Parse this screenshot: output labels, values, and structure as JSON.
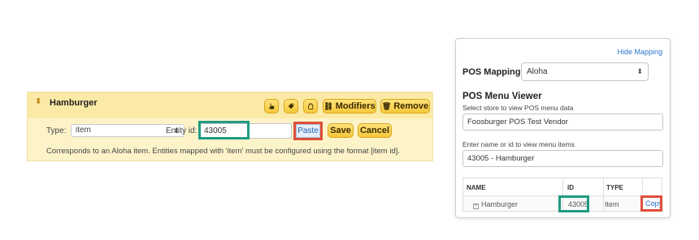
{
  "entity": {
    "name": "Hamburger",
    "sort_icon": "sort-arrows-icon",
    "toolbar": {
      "icon1": "hand-pointer-icon",
      "icon2": "tag-icon",
      "icon3": "hand-icon",
      "modifiers_label": "Modifiers",
      "remove_label": "Remove"
    },
    "type_label": "Type:",
    "type_value": "item",
    "entity_label": "Entity id:",
    "entity_value": "43005",
    "paste_label": "Paste",
    "save_label": "Save",
    "cancel_label": "Cancel",
    "help_text": "Corresponds to an Aloha item. Entities mapped with 'item' must be configured using the format [item id]."
  },
  "panel": {
    "hide_mapping": "Hide Mapping",
    "pos_mapping_label": "POS Mapping:",
    "pos_mapping_value": "Aloha",
    "viewer_title": "POS Menu Viewer",
    "store_label": "Select store to view POS menu data",
    "store_value": "Foosburger POS Test Vendor",
    "search_label": "Enter name or id to view menu items",
    "search_value": "43005 - Hamburger",
    "table": {
      "headers": [
        "NAME",
        "ID",
        "TYPE"
      ],
      "rows": [
        {
          "name": "Hamburger",
          "id": "43005",
          "type": "Item",
          "action": "Copy"
        }
      ]
    }
  },
  "colors": {
    "highlight_green": "#1f9b82",
    "highlight_red": "#e04f3b",
    "button_yellow": "#f6c83a",
    "link_blue": "#2b73c9"
  }
}
